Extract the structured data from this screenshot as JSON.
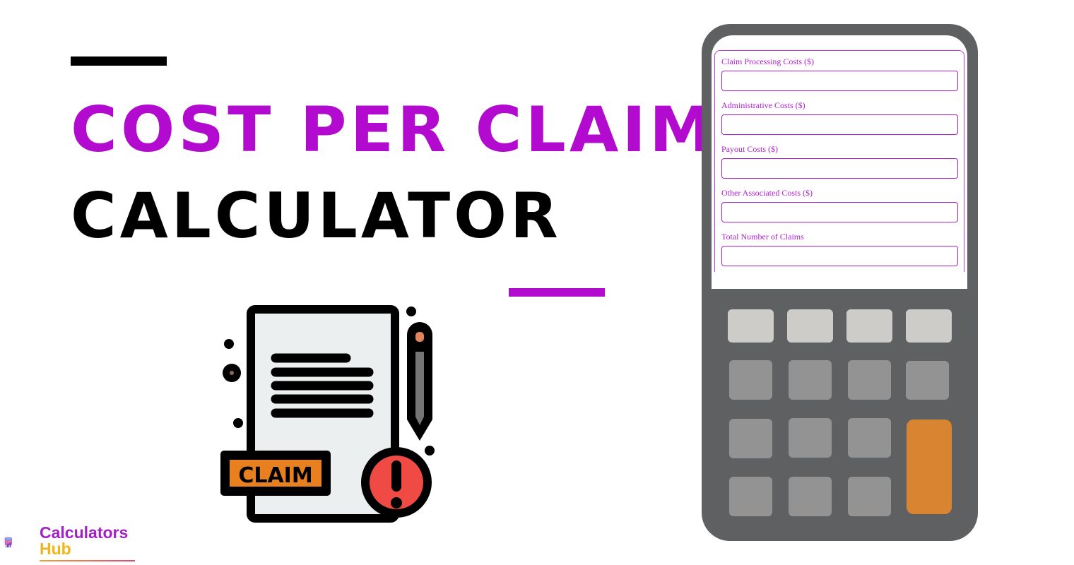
{
  "header": {
    "title_line1": "COST PER CLAIM",
    "title_line2": "CALCULATOR"
  },
  "illustration": {
    "badge_text": "CLAIM",
    "icon": "claim-document-icon"
  },
  "form": {
    "fields": [
      {
        "label": "Claim Processing Costs ($)",
        "value": "",
        "placeholder": ""
      },
      {
        "label": "Administrative Costs ($)",
        "value": "",
        "placeholder": ""
      },
      {
        "label": "Payout Costs ($)",
        "value": "",
        "placeholder": ""
      },
      {
        "label": "Other Associated Costs ($)",
        "value": "",
        "placeholder": ""
      },
      {
        "label": "Total Number of Claims",
        "value": "",
        "placeholder": ""
      }
    ]
  },
  "logo": {
    "line1": "Calculators",
    "line2": "Hub"
  },
  "colors": {
    "accent": "#b20bcf",
    "calculator_body": "#5f6062",
    "key_light": "#cdccc9",
    "key_mid": "#939393",
    "key_equals": "#d98430",
    "claim_badge": "#e8801f",
    "alert_red": "#f04a45"
  }
}
